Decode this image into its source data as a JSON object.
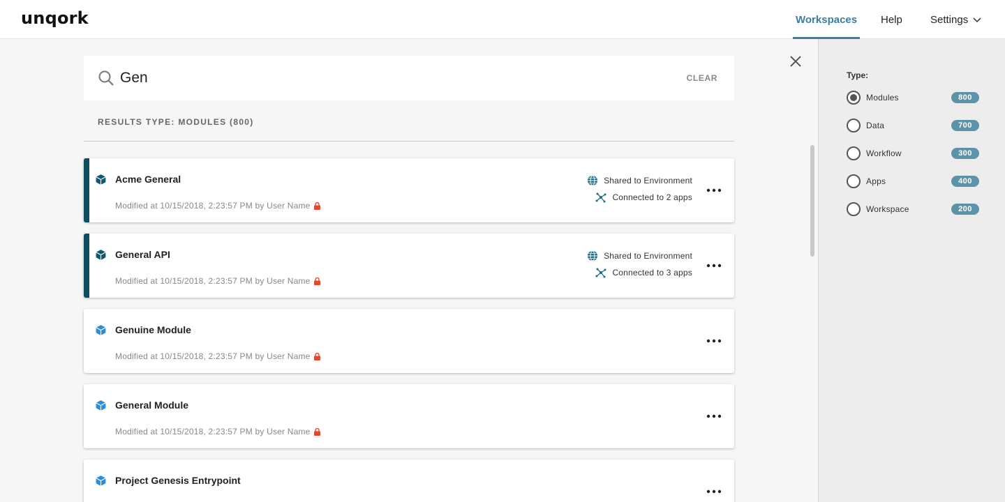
{
  "header": {
    "logo": "unqork",
    "nav": {
      "workspaces": "Workspaces",
      "help": "Help",
      "settings": "Settings"
    }
  },
  "search": {
    "value": "Gen",
    "clear_label": "CLEAR"
  },
  "results_label": "RESULTS TYPE: MODULES (800)",
  "cards": [
    {
      "title": "Acme General",
      "meta": "Modified at 10/15/2018, 2:23:57 PM by User Name",
      "shared": "Shared to Environment",
      "connected": "Connected to 2 apps"
    },
    {
      "title": "General API",
      "meta": "Modified at 10/15/2018, 2:23:57 PM by User Name",
      "shared": "Shared to Environment",
      "connected": "Connected to 3 apps"
    },
    {
      "title": "Genuine Module",
      "meta": "Modified at 10/15/2018, 2:23:57 PM by User Name"
    },
    {
      "title": "General Module",
      "meta": "Modified at 10/15/2018, 2:23:57 PM by User Name"
    },
    {
      "title": "Project Genesis Entrypoint"
    }
  ],
  "filter": {
    "label": "Type:",
    "options": [
      {
        "label": "Modules",
        "count": "800",
        "selected": true
      },
      {
        "label": "Data",
        "count": "700",
        "selected": false
      },
      {
        "label": "Workflow",
        "count": "300",
        "selected": false
      },
      {
        "label": "Apps",
        "count": "400",
        "selected": false
      },
      {
        "label": "Workspace",
        "count": "200",
        "selected": false
      }
    ]
  },
  "colors": {
    "accent": "#3b7ea1",
    "card_accent": "#0d4f5f",
    "badge": "#5b93a7",
    "lock": "#e0492f"
  }
}
